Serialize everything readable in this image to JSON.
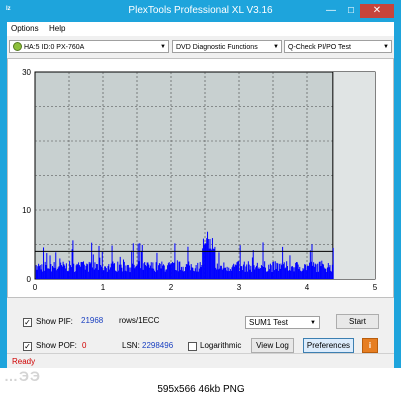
{
  "window": {
    "title": "PlexTools Professional XL V3.16",
    "icon_text": "lz",
    "buttons": {
      "minimize": "—",
      "maximize": "☐",
      "close": "✕"
    }
  },
  "menu": [
    {
      "label": "Options"
    },
    {
      "label": "Help"
    }
  ],
  "toolbar": {
    "drive": "HA:5 ID:0  PX-760A",
    "function": "DVD Diagnostic Functions",
    "test": "Q-Check PI/PO Test"
  },
  "chart_data": {
    "type": "bar",
    "title": "",
    "xlabel": "",
    "ylabel": "",
    "xlim": [
      0,
      5
    ],
    "ylim": [
      0,
      30
    ],
    "x_ticks": [
      0,
      1,
      2,
      3,
      4,
      5
    ],
    "y_ticks": [
      0,
      10,
      30
    ],
    "y_tick_labels": [
      "0",
      "10",
      "30"
    ],
    "scan_end": 4.38,
    "threshold": 4,
    "grid": true,
    "bar_color": "#0000ff",
    "plot_bg": "#c8d0d0"
  },
  "controls": {
    "show_pif_label": "Show PIF:",
    "pif_value": "21968",
    "pif_unit": "rows/1ECC",
    "show_pof_label": "Show POF:",
    "pof_value": "0",
    "lsn_label": "LSN:",
    "lsn_value": "2298496",
    "logarithmic_label": "Logarithmic",
    "sum_select": "SUM1 Test",
    "start_button": "Start",
    "view_log_button": "View Log",
    "preferences_button": "Preferences",
    "info_button": "i",
    "check_mark": "✓"
  },
  "status": {
    "text": "Ready"
  },
  "footer": {
    "background_text": "…ЭЭ",
    "caption": "595x566 46kb PNG"
  }
}
